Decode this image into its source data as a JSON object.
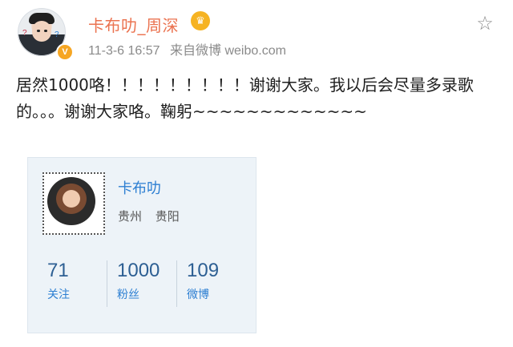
{
  "post": {
    "username": "卡布叻_周深",
    "timestamp": "11-3-6 16:57",
    "source": "来自微博 weibo.com",
    "content": "居然1000咯！！！！！！！！！谢谢大家。我以后会尽量多录歌的。。。谢谢大家咯。鞠躬~~~~~~~~~~~~~",
    "icons": {
      "avatar": "profile-avatar",
      "verified": "verified-badge",
      "crown": "crown-icon",
      "favorite": "star-icon"
    }
  },
  "card": {
    "name": "卡布叻",
    "location": [
      "贵州",
      "贵阳"
    ],
    "stats": [
      {
        "number": "71",
        "label": "关注"
      },
      {
        "number": "1000",
        "label": "粉丝"
      },
      {
        "number": "109",
        "label": "微博"
      }
    ]
  },
  "colors": {
    "username": "#eb7350",
    "link_blue": "#2d7fd2",
    "card_bg": "#edf3f8"
  }
}
